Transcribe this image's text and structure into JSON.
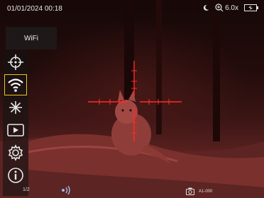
{
  "status_bar": {
    "datetime": "01/01/2024 00:18",
    "moon_icon": "moon-icon",
    "zoom_icon": "zoom-icon",
    "zoom_level": "6.0x",
    "battery_icon": "battery-icon"
  },
  "menu_panel": {
    "title": "WiFi"
  },
  "sidebar": {
    "items": [
      {
        "icon": "crosshair-icon"
      },
      {
        "icon": "wifi-icon"
      },
      {
        "icon": "brightness-icon"
      },
      {
        "icon": "playback-icon"
      },
      {
        "icon": "settings-gear-icon"
      },
      {
        "icon": "info-icon"
      }
    ],
    "page": "1/2"
  },
  "bottom": {
    "left_icon": "audio-wave-icon",
    "camera_icon": "camera-icon",
    "device_id": "A1-000"
  },
  "colors": {
    "reticle": "#ff2a2a",
    "selection": "#f1c21b"
  }
}
